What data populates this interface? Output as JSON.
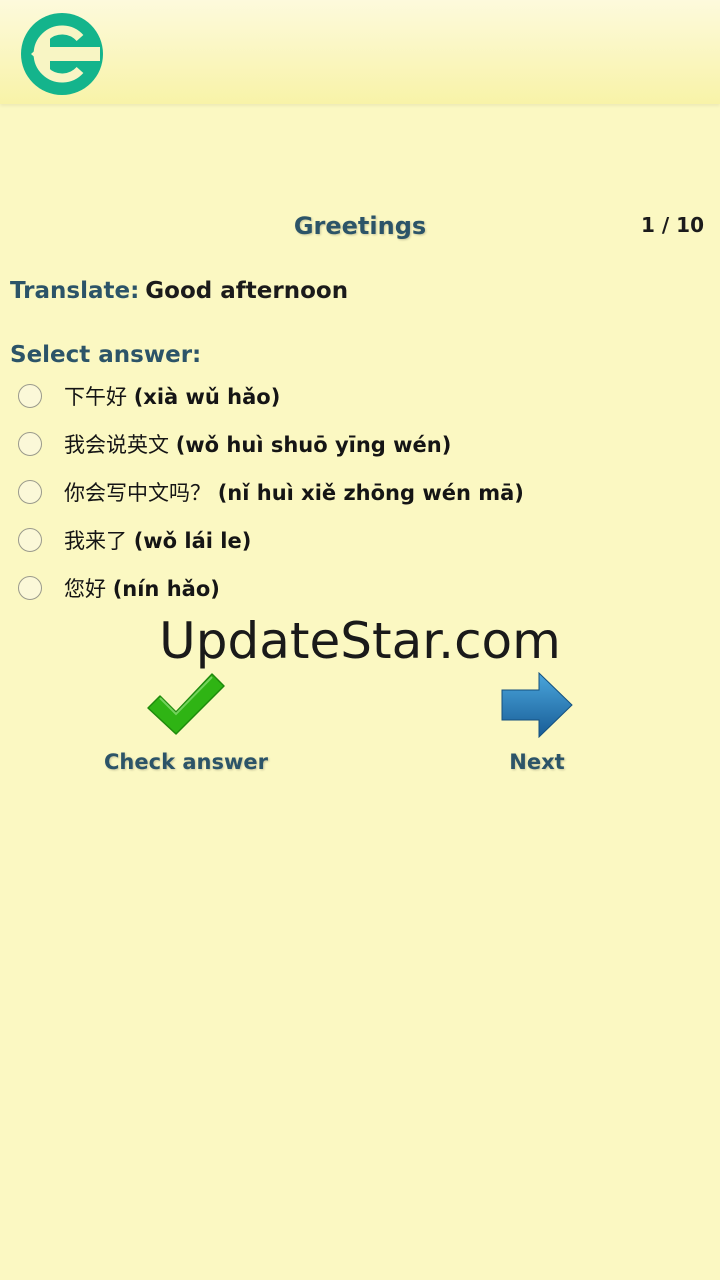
{
  "header": {
    "back_icon": "arrow-left-circle-icon",
    "back_color": "#14b48c"
  },
  "quiz": {
    "title": "Greetings",
    "counter": "1 / 10",
    "translate_label": "Translate:",
    "phrase": "Good afternoon",
    "select_label": "Select answer:",
    "options": [
      {
        "hanzi": "下午好",
        "pinyin": "(xià wǔ hǎo)"
      },
      {
        "hanzi": "我会说英文",
        "pinyin": "(wǒ huì shuō yīng wén)"
      },
      {
        "hanzi": "你会写中文吗？",
        "pinyin": "(nǐ huì xiě zhōng wén mā)"
      },
      {
        "hanzi": "我来了",
        "pinyin": "(wǒ lái le)"
      },
      {
        "hanzi": "您好",
        "pinyin": "(nín hǎo)"
      }
    ]
  },
  "watermark": "UpdateStar.com",
  "actions": {
    "check_label": "Check answer",
    "check_icon": "checkmark-icon",
    "next_label": "Next",
    "next_icon": "arrow-right-icon"
  },
  "colors": {
    "background": "#fbf8c2",
    "heading": "#2c5468",
    "check": "#2fb414",
    "next": "#1f78b4"
  }
}
